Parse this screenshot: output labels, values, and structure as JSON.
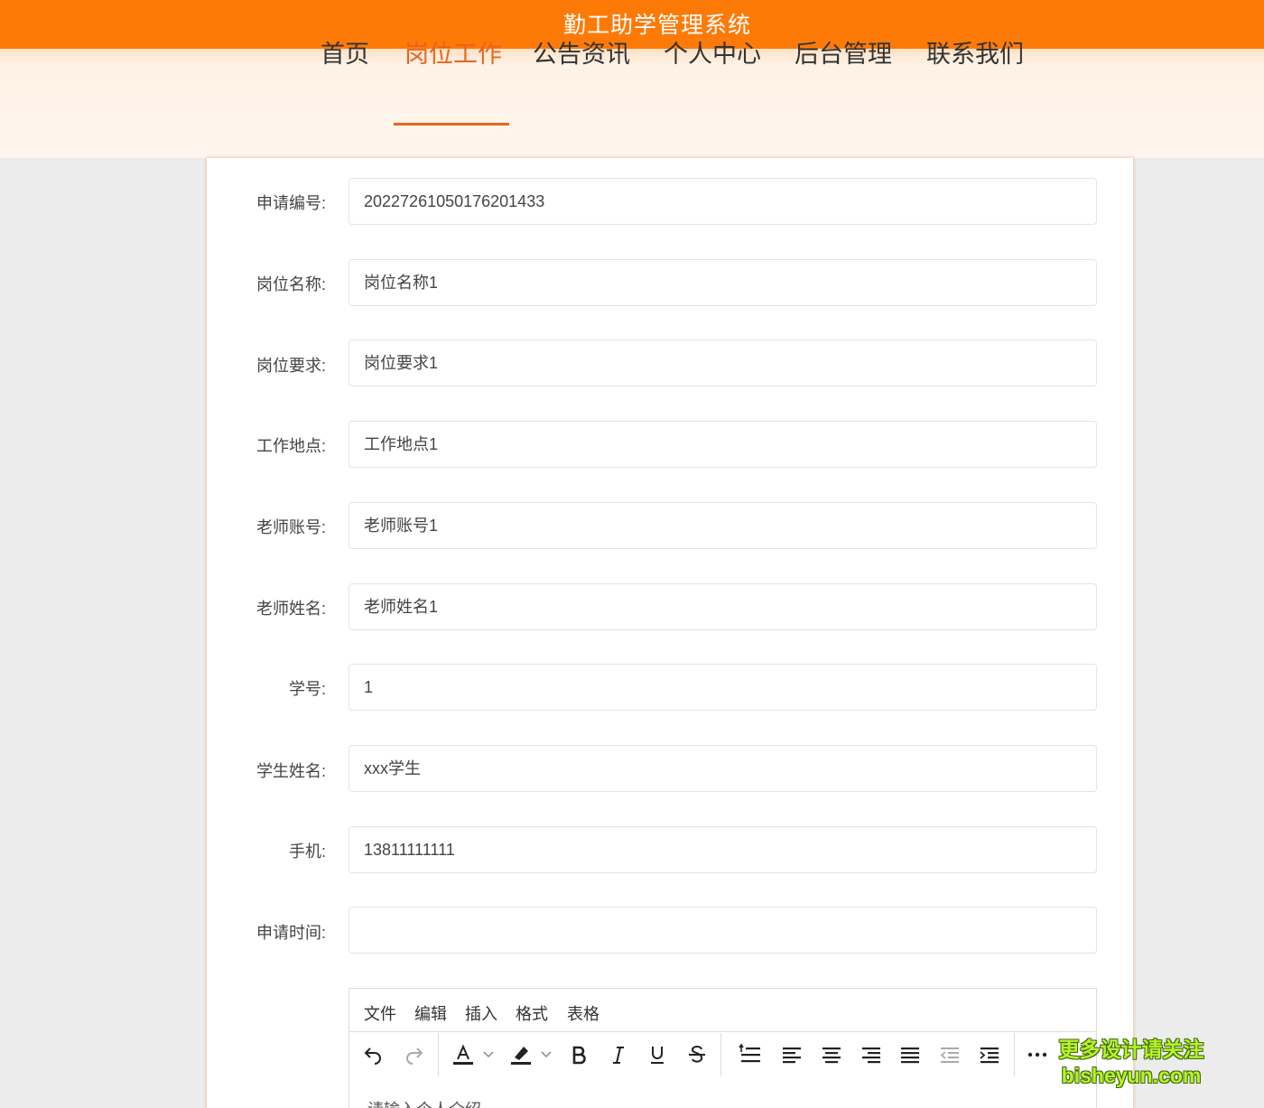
{
  "app": {
    "title": "勤工助学管理系统"
  },
  "nav": {
    "items": [
      {
        "label": "首页",
        "active": false
      },
      {
        "label": "岗位工作",
        "active": true
      },
      {
        "label": "公告资讯",
        "active": false
      },
      {
        "label": "个人中心",
        "active": false
      },
      {
        "label": "后台管理",
        "active": false
      },
      {
        "label": "联系我们",
        "active": false
      }
    ]
  },
  "form": {
    "fields": [
      {
        "label": "申请编号:",
        "value": "20227261050176201433"
      },
      {
        "label": "岗位名称:",
        "value": "岗位名称1"
      },
      {
        "label": "岗位要求:",
        "value": "岗位要求1"
      },
      {
        "label": "工作地点:",
        "value": "工作地点1"
      },
      {
        "label": "老师账号:",
        "value": "老师账号1"
      },
      {
        "label": "老师姓名:",
        "value": "老师姓名1"
      },
      {
        "label": "学号:",
        "value": "1"
      },
      {
        "label": "学生姓名:",
        "value": "xxx学生"
      },
      {
        "label": "手机:",
        "value": "13811111111"
      },
      {
        "label": "申请时间:",
        "value": ""
      }
    ]
  },
  "editor": {
    "menu": [
      "文件",
      "编辑",
      "插入",
      "格式",
      "表格"
    ],
    "toolbar_icons": [
      "undo-icon",
      "redo-icon",
      "text-color-icon",
      "highlight-icon",
      "bold-icon",
      "italic-icon",
      "underline-icon",
      "strikethrough-icon",
      "line-height-icon",
      "align-left-icon",
      "align-center-icon",
      "align-right-icon",
      "align-justify-icon",
      "outdent-icon",
      "indent-icon",
      "more-icon"
    ],
    "placeholder": "请输入个人介绍"
  },
  "watermark": {
    "line1": "更多设计请关注",
    "line2": "bisheyun.com"
  },
  "colors": {
    "primary": "#fe7a07",
    "accent": "#e8641e",
    "nav_bg": "#fef5ec",
    "page_bg": "#ececec"
  }
}
